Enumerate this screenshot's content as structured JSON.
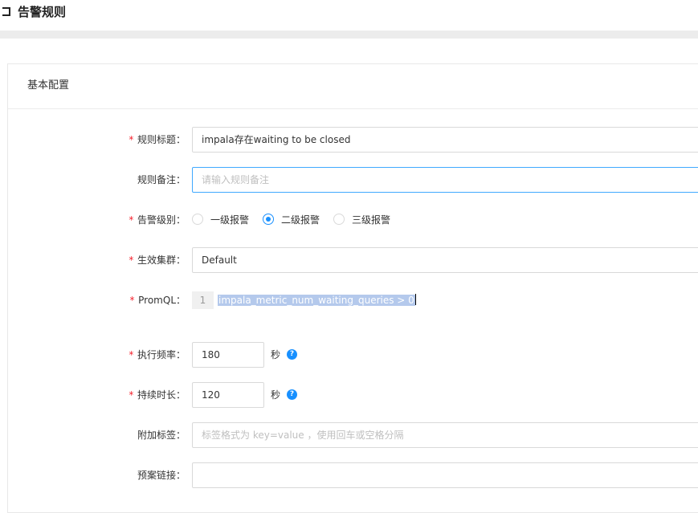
{
  "page": {
    "title": "告警规则"
  },
  "section": {
    "title": "基本配置"
  },
  "form": {
    "rule_title": {
      "label": "规则标题：",
      "required": true,
      "value": "impala存在waiting to be closed"
    },
    "rule_note": {
      "label": "规则备注：",
      "required": false,
      "placeholder": "请输入规则备注"
    },
    "alert_level": {
      "label": "告警级别：",
      "required": true,
      "options": [
        "一级报警",
        "二级报警",
        "三级报警"
      ],
      "selected": "二级报警"
    },
    "cluster": {
      "label": "生效集群：",
      "required": true,
      "value": "Default"
    },
    "promql": {
      "label": "PromQL：",
      "required": true,
      "line_number": "1",
      "code": "impala_metric_num_waiting_queries > 0"
    },
    "exec_freq": {
      "label": "执行频率：",
      "required": true,
      "value": "180",
      "unit": "秒"
    },
    "duration": {
      "label": "持续时长：",
      "required": true,
      "value": "120",
      "unit": "秒"
    },
    "extra_tags": {
      "label": "附加标签：",
      "required": false,
      "placeholder": "标签格式为 key=value ，使用回车或空格分隔"
    },
    "runbook": {
      "label": "预案链接：",
      "required": false,
      "value": ""
    }
  },
  "colors": {
    "accent": "#1890ff",
    "required": "#f5222d",
    "selection": "#b4c9ec"
  }
}
